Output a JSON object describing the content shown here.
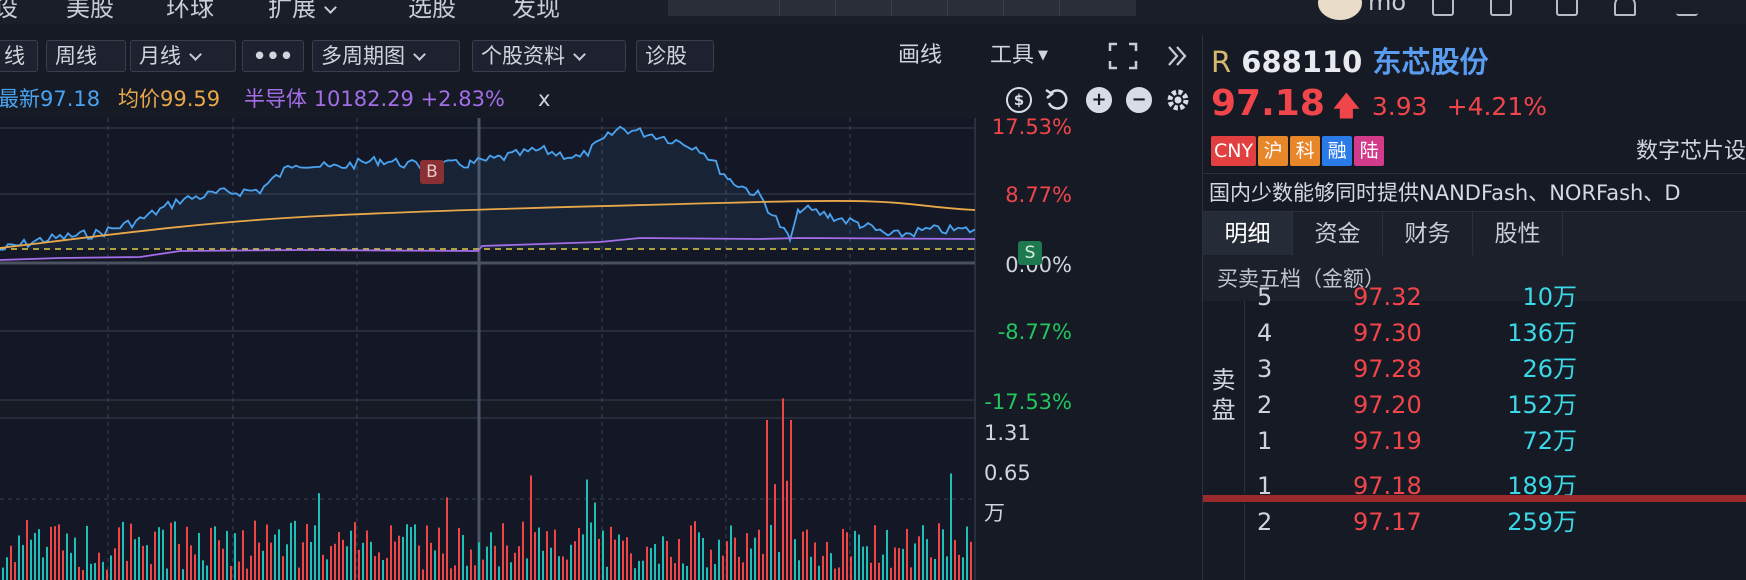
{
  "nav": {
    "items": [
      "设",
      "美股",
      "环球",
      "扩展",
      "选股",
      "发现"
    ],
    "user_name": "mo"
  },
  "toolbar": {
    "day_btn": "线",
    "week_btn": "周线",
    "month_btn": "月线",
    "more_btn": "•••",
    "multi_period_btn": "多周期图",
    "stock_info_btn": "个股资料",
    "diagnose_btn": "诊股",
    "draw_btn": "画线",
    "tools_btn": "工具"
  },
  "info": {
    "latest": "最新97.18",
    "avg": "均价99.59",
    "sector_name": "半导体",
    "sector_value": "10182.29",
    "sector_change": "+2.83%",
    "close": "x"
  },
  "chart_data": {
    "type": "line",
    "pct_ticks": [
      "17.53%",
      "8.77%",
      "0.00%",
      "-8.77%",
      "-17.53%"
    ],
    "vol_ticks": [
      "1.31",
      "0.65",
      "万"
    ],
    "markers": [
      "B",
      "S"
    ],
    "colors": {
      "price": "#4aa3f0",
      "avg": "#e8a84a",
      "sector": "#a36ee8",
      "up": "#f04545",
      "down": "#1fbfb8",
      "grid": "#39404f"
    }
  },
  "stock": {
    "prefix": "R",
    "code": "688110",
    "name": "东芯股份",
    "price": "97.18",
    "change": "3.93",
    "change_pct": "+4.21%",
    "tags": [
      {
        "text": "CNY",
        "color": "#e24040"
      },
      {
        "text": "沪",
        "color": "#e8862a"
      },
      {
        "text": "科",
        "color": "#e8862a"
      },
      {
        "text": "融",
        "color": "#2a7ae8"
      },
      {
        "text": "陆",
        "color": "#d23a8a"
      }
    ],
    "sector": "数字芯片设",
    "description": "国内少数能够同时提供NANDFash、NORFash、D"
  },
  "tabs": [
    "明细",
    "资金",
    "财务",
    "股性"
  ],
  "orderbook": {
    "title": "买卖五档（金额）",
    "sell_label": "卖盘",
    "sell": [
      {
        "level": "5",
        "price": "97.32",
        "amount": "10万"
      },
      {
        "level": "4",
        "price": "97.30",
        "amount": "136万"
      },
      {
        "level": "3",
        "price": "97.28",
        "amount": "26万"
      },
      {
        "level": "2",
        "price": "97.20",
        "amount": "152万"
      },
      {
        "level": "1",
        "price": "97.19",
        "amount": "72万"
      }
    ],
    "buy": [
      {
        "level": "1",
        "price": "97.18",
        "amount": "189万"
      },
      {
        "level": "2",
        "price": "97.17",
        "amount": "259万"
      }
    ]
  }
}
